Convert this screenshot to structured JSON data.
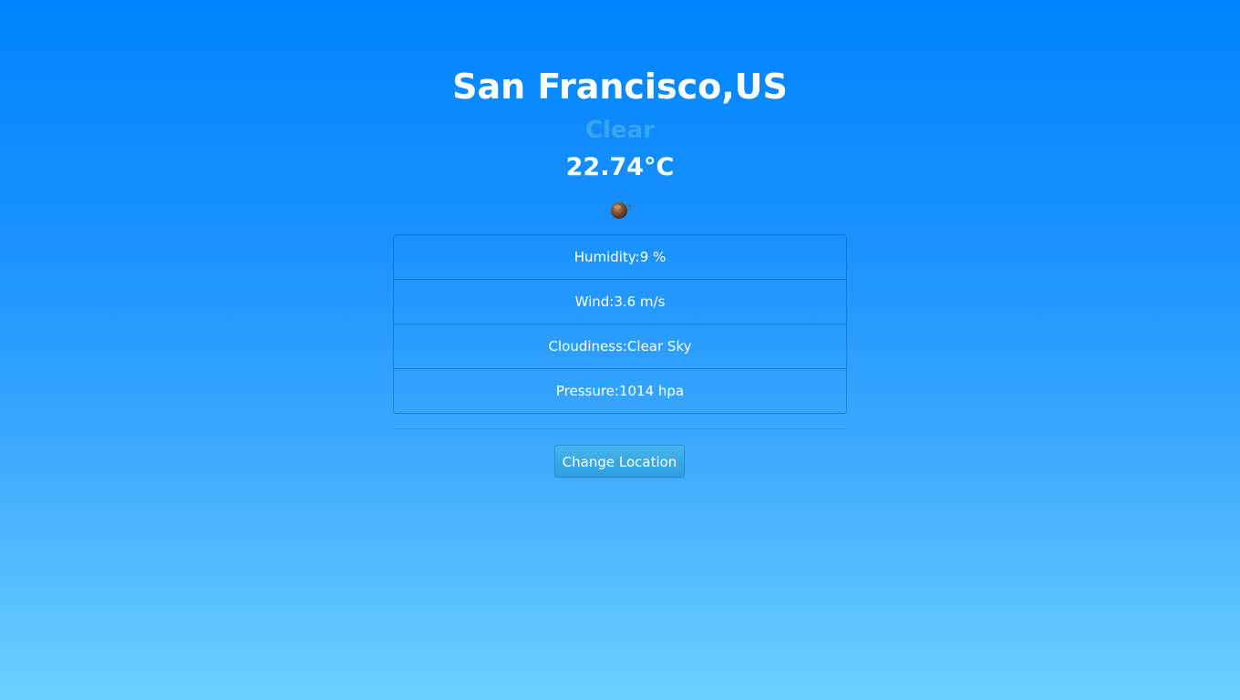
{
  "location": {
    "city": "San Francisco,US"
  },
  "weather": {
    "condition": "Clear",
    "temperature": "22.74°C",
    "icon": "clear-night-icon"
  },
  "details": [
    "Humidity:9 %",
    "Wind:3.6 m/s",
    "Cloudiness:Clear Sky",
    "Pressure:1014 hpa"
  ],
  "actions": {
    "change_location_label": "Change Location"
  },
  "colors": {
    "background_top": "#0084ff",
    "background_bottom": "#6bd1ff",
    "condition_text": "#3aa6f0",
    "button": "#2d9fdf"
  }
}
